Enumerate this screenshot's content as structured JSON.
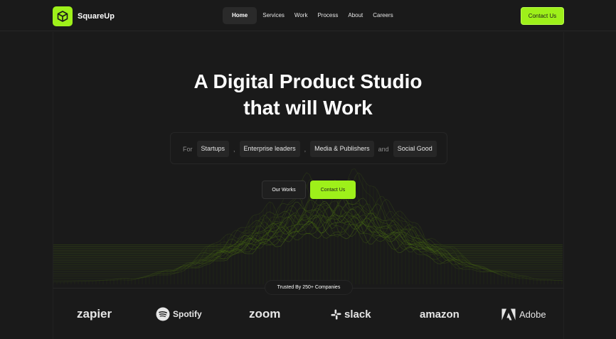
{
  "brand": {
    "name": "SquareUp",
    "accent": "#9ef01a",
    "background": "#1a1a1a"
  },
  "nav": {
    "items": [
      {
        "label": "Home",
        "active": true
      },
      {
        "label": "Services",
        "active": false
      },
      {
        "label": "Work",
        "active": false
      },
      {
        "label": "Process",
        "active": false
      },
      {
        "label": "About",
        "active": false
      },
      {
        "label": "Careers",
        "active": false
      }
    ],
    "contact_label": "Contact Us"
  },
  "hero": {
    "title_line1": "A Digital Product Studio",
    "title_line2": "that will Work",
    "for_label": "For",
    "tags": [
      "Startups",
      "Enterprise leaders",
      "Media & Publishers",
      "Social Good"
    ],
    "separators": [
      ",",
      ",",
      "and"
    ],
    "works_button": "Our Works",
    "contact_button": "Contact Us"
  },
  "trusted": {
    "label": "Trusted By 250+ Companies",
    "companies": [
      "zapier",
      "Spotify",
      "zoom",
      "slack",
      "amazon",
      "Adobe"
    ]
  }
}
